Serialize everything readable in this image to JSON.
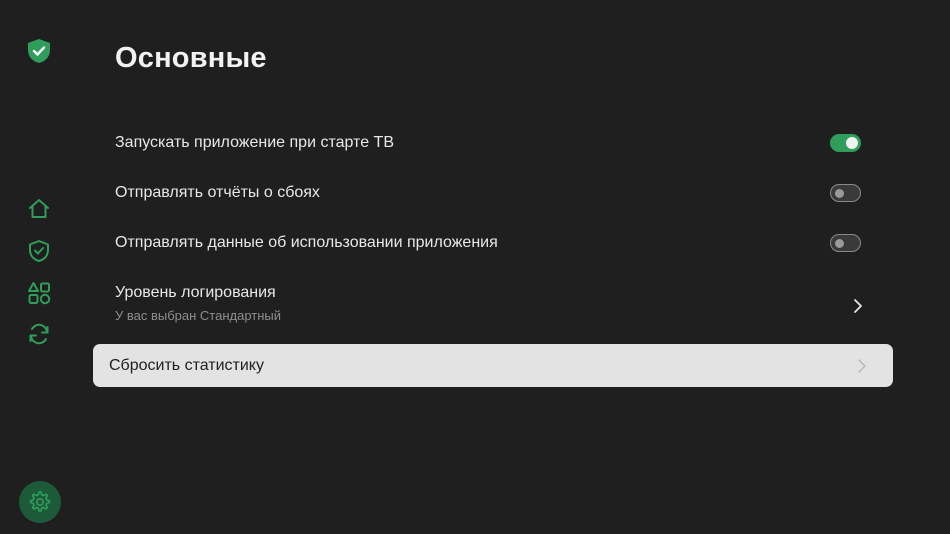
{
  "title": "Основные",
  "colors": {
    "accent": "#2e9e5a",
    "background": "#1f1f1f",
    "focus_background": "#e3e3e3"
  },
  "sidebar": {
    "logo_icon": "shield-check-icon",
    "items": [
      {
        "icon": "home-icon"
      },
      {
        "icon": "shield-icon"
      },
      {
        "icon": "apps-icon"
      },
      {
        "icon": "sync-icon"
      },
      {
        "icon": "gear-icon",
        "selected": true
      }
    ]
  },
  "settings": {
    "autostart": {
      "label": "Запускать приложение при старте ТВ",
      "enabled": true
    },
    "crash_reports": {
      "label": "Отправлять отчёты о сбоях",
      "enabled": false
    },
    "usage_data": {
      "label": "Отправлять данные об использовании приложения",
      "enabled": false
    },
    "logging": {
      "label": "Уровень логирования",
      "sublabel": "У вас выбран Стандартный"
    },
    "reset_stats": {
      "label": "Сбросить статистику",
      "focused": true
    }
  }
}
